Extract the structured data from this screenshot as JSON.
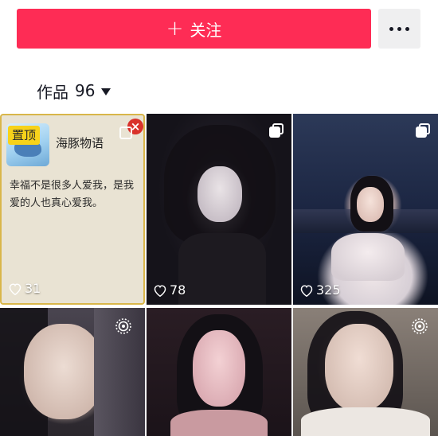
{
  "header": {
    "follow_label": "关注",
    "follow_icon": "plus-icon",
    "more_icon": "more-dots-icon",
    "colors": {
      "follow_bg": "#fe2c55",
      "more_bg": "#efeff0"
    }
  },
  "tabs": {
    "works_label": "作品",
    "works_count": "96"
  },
  "pinned_post": {
    "badge": "置顶",
    "app_name": "海豚物语",
    "text": "幸福不是很多人爱我，是我爱的人也真心爱我。",
    "likes": "31",
    "close_glyph": "×"
  },
  "tiles": [
    {
      "likes": "78",
      "badge_icon": "collection-icon"
    },
    {
      "likes": "325",
      "badge_icon": "collection-icon"
    },
    {
      "likes": "",
      "badge_icon": "live-photo-icon"
    },
    {
      "likes": "",
      "badge_icon": ""
    },
    {
      "likes": "",
      "badge_icon": "live-photo-icon"
    }
  ]
}
